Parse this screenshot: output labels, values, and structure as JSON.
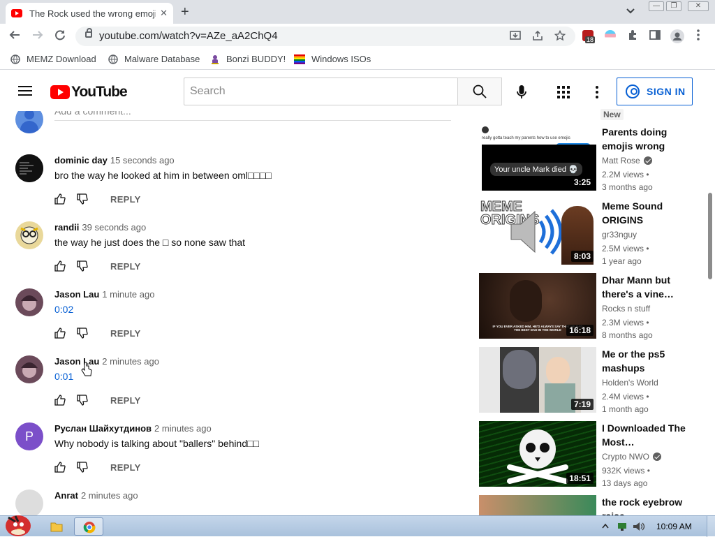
{
  "browser": {
    "tab_title": "The Rock used the wrong emoji",
    "tab_close": "✕",
    "new_tab": "+",
    "url": "youtube.com/watch?v=AZe_aA2ChQ4",
    "extension_badge": "18",
    "window_controls": [
      "—",
      "❐",
      "✕"
    ]
  },
  "bookmarks": [
    {
      "label": "MEMZ Download",
      "icon": "globe-icon"
    },
    {
      "label": "Malware Database",
      "icon": "globe-icon"
    },
    {
      "label": "Bonzi BUDDY!",
      "icon": "bonzi-icon"
    },
    {
      "label": "Windows ISOs",
      "icon": "windows-flag-icon"
    }
  ],
  "youtube": {
    "logo_text": "YouTube",
    "search_placeholder": "Search",
    "sign_in": "SIGN IN"
  },
  "comments": {
    "add_placeholder": "Add a comment...",
    "reply_label": "REPLY",
    "items": [
      {
        "author": "dominic day",
        "time": "15 seconds ago",
        "text": "bro the way he looked at him in between oml□□□□",
        "link": false,
        "avatar": "#111111"
      },
      {
        "author": "randii",
        "time": "39 seconds ago",
        "text": "the way he just does the □ so none saw that",
        "link": false,
        "avatar": "#e9d89a"
      },
      {
        "author": "Jason Lau",
        "time": "1 minute ago",
        "text": "0:02",
        "link": true,
        "avatar": "#6b4a5a"
      },
      {
        "author": "Jason Lau",
        "time": "2 minutes ago",
        "text": "0:01",
        "link": true,
        "avatar": "#6b4a5a"
      },
      {
        "author": "Руслан Шайхутдинов",
        "time": "2 minutes ago",
        "text": "Why nobody is talking about \"ballers\" behind□□",
        "link": false,
        "avatar": "#7b4fc9",
        "initial": "P"
      },
      {
        "author": "Anrat",
        "time": "2 minutes ago",
        "text": "",
        "link": false,
        "avatar": "#dddddd"
      }
    ]
  },
  "related": {
    "new_badge": "New",
    "videos": [
      {
        "title": "Parents doing emojis wrong",
        "channel": "Matt Rose",
        "verified": true,
        "views": "2.2M views •",
        "age": "3 months ago",
        "duration": "3:25",
        "thumb_caption": "Your uncle Mark died 💀",
        "thumb_header": "really gotta teach my parents how to use emojis"
      },
      {
        "title": "Meme Sound ORIGINS",
        "channel": "gr33nguy",
        "verified": false,
        "views": "2.5M views •",
        "age": "1 year ago",
        "duration": "8:03",
        "thumb_caption": "MEME ORIGINS"
      },
      {
        "title": "Dhar Mann but there's a vine…",
        "channel": "Rocks n stuff",
        "verified": false,
        "views": "2.3M views •",
        "age": "8 months ago",
        "duration": "16:18",
        "thumb_caption": "IF YOU EVER ASKED HIM, HE'D ALWAYS SAY THAT HE HAD THE BEST DAD IN THE WORLD"
      },
      {
        "title": "Me or the ps5 mashups",
        "channel": "Holden's World",
        "verified": false,
        "views": "2.4M views •",
        "age": "1 month ago",
        "duration": "7:19"
      },
      {
        "title": "I Downloaded The Most…",
        "channel": "Crypto NWO",
        "verified": true,
        "views": "932K views •",
        "age": "13 days ago",
        "duration": "18:51"
      },
      {
        "title": "the rock eyebrow raise…",
        "channel": "",
        "verified": false,
        "views": "",
        "age": "",
        "duration": ""
      }
    ]
  },
  "taskbar": {
    "clock": "10:09 AM"
  },
  "colors": {
    "youtube_red": "#ff0000",
    "link_blue": "#065fd4",
    "chrome_tabstrip": "#dee1e6"
  }
}
